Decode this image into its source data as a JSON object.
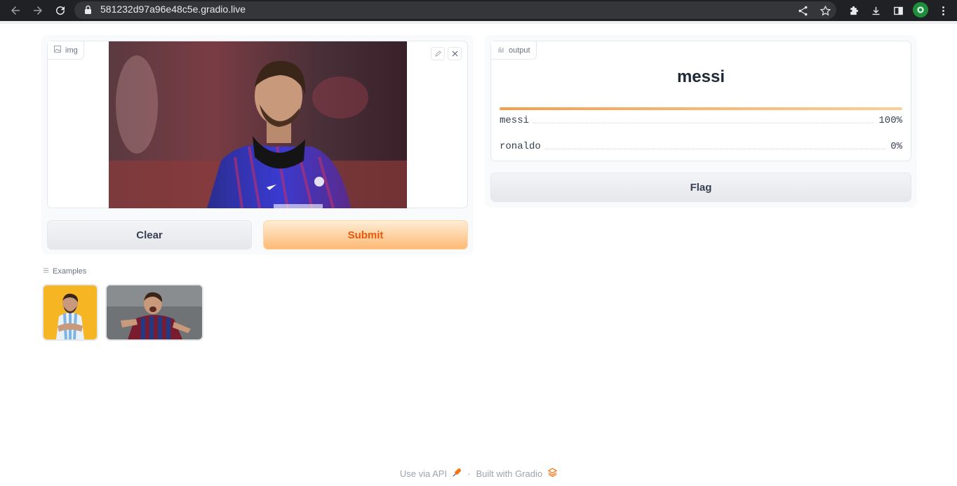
{
  "browser": {
    "url": "581232d97a96e48c5e.gradio.live",
    "icons": [
      "back-arrow-icon",
      "forward-arrow-icon",
      "reload-icon",
      "lock-icon",
      "share-icon",
      "star-icon",
      "extensions-icon",
      "download-icon",
      "sidepanel-icon",
      "profile-avatar",
      "menu-dots-icon"
    ]
  },
  "input": {
    "label": "img",
    "icons": [
      "image-icon",
      "edit-icon",
      "close-icon"
    ]
  },
  "buttons": {
    "clear": "Clear",
    "submit": "Submit",
    "flag": "Flag"
  },
  "output": {
    "label": "output",
    "predicted": "messi",
    "top_confidence": 1.0,
    "confidences": [
      {
        "label": "messi",
        "value": "100%"
      },
      {
        "label": "ronaldo",
        "value": "0%"
      }
    ]
  },
  "examples": {
    "label": "Examples",
    "items": [
      "example-1",
      "example-2"
    ]
  },
  "footer": {
    "api": "Use via API",
    "separator": "·",
    "built": "Built with Gradio"
  },
  "colors": {
    "accent": "#f97316",
    "primary_text": "#ea580c",
    "chrome_bg": "#202124"
  }
}
